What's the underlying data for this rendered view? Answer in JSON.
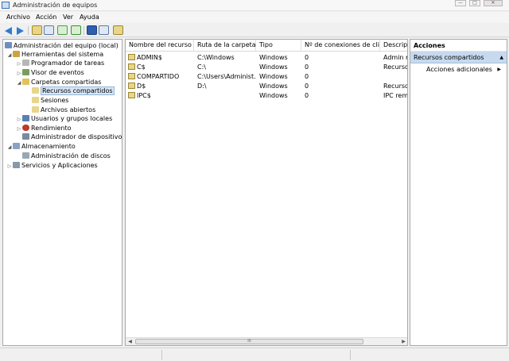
{
  "window": {
    "title": "Administración de equipos"
  },
  "menu": [
    "Archivo",
    "Acción",
    "Ver",
    "Ayuda"
  ],
  "tree": {
    "items": [
      {
        "label": "Administración del equipo (local)",
        "expander": "",
        "icon": "computer-icon",
        "color": "#6d8fbf"
      },
      {
        "label": "Herramientas del sistema",
        "expander": "◢",
        "icon": "tools-icon",
        "color": "#c9a441"
      },
      {
        "label": "Programador de tareas",
        "expander": "▷",
        "icon": "clock-icon",
        "color": "#b7b7b7"
      },
      {
        "label": "Visor de eventos",
        "expander": "▷",
        "icon": "event-viewer-icon",
        "color": "#7a9c5f"
      },
      {
        "label": "Carpetas compartidas",
        "expander": "◢",
        "icon": "shared-folder-icon",
        "color": "#e3c25b"
      },
      {
        "label": "Recursos compartidos",
        "expander": "",
        "icon": "share-icon",
        "color": "#e7d58a"
      },
      {
        "label": "Sesiones",
        "expander": "",
        "icon": "share-icon",
        "color": "#e7d58a"
      },
      {
        "label": "Archivos abiertos",
        "expander": "",
        "icon": "share-icon",
        "color": "#e7d58a"
      },
      {
        "label": "Usuarios y grupos locales",
        "expander": "▷",
        "icon": "users-icon",
        "color": "#5b7fb5"
      },
      {
        "label": "Rendimiento",
        "expander": "▷",
        "icon": "performance-icon",
        "color": "#c0392b"
      },
      {
        "label": "Administrador de dispositivos",
        "expander": "",
        "icon": "device-manager-icon",
        "color": "#7b8a9c"
      },
      {
        "label": "Almacenamiento",
        "expander": "◢",
        "icon": "storage-icon",
        "color": "#8aa2c2"
      },
      {
        "label": "Administración de discos",
        "expander": "",
        "icon": "disk-icon",
        "color": "#9aa7b5"
      },
      {
        "label": "Servicios y Aplicaciones",
        "expander": "▷",
        "icon": "services-icon",
        "color": "#8898a8"
      }
    ]
  },
  "list": {
    "columns": [
      "Nombre del recurso",
      "Ruta de la carpeta",
      "Tipo",
      "Nº de conexiones de clie...",
      "Descripci"
    ],
    "rows": [
      [
        "ADMIN$",
        "C:\\Windows",
        "Windows",
        "0",
        "Admin re"
      ],
      [
        "C$",
        "C:\\",
        "Windows",
        "0",
        "Recurso"
      ],
      [
        "COMPARTIDO",
        "C:\\Users\\Administ...",
        "Windows",
        "0",
        ""
      ],
      [
        "D$",
        "D:\\",
        "Windows",
        "0",
        "Recurso"
      ],
      [
        "IPC$",
        "",
        "Windows",
        "0",
        "IPC remo"
      ]
    ],
    "scroll_thumb": "III"
  },
  "actions": {
    "header": "Acciones",
    "section": "Recursos compartidos",
    "item": "Acciones adicionales"
  }
}
